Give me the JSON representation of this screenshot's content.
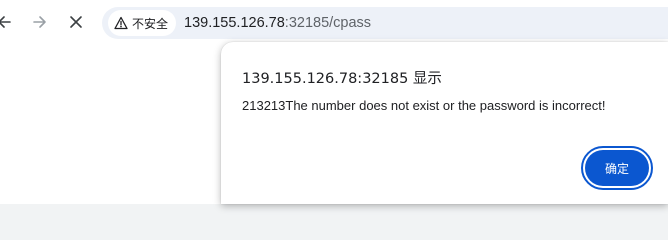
{
  "browser": {
    "security_label": "不安全",
    "url_host": "139.155.126.78",
    "url_port_path": ":32185/cpass",
    "icons": {
      "back": "arrow-left-icon",
      "forward": "arrow-right-icon",
      "stop": "close-icon",
      "security": "warning-triangle-icon"
    }
  },
  "dialog": {
    "title": "139.155.126.78:32185 显示",
    "message": "213213The number does not exist or the password is incorrect!",
    "ok_label": "确定",
    "accent_color": "#0b57d0"
  }
}
